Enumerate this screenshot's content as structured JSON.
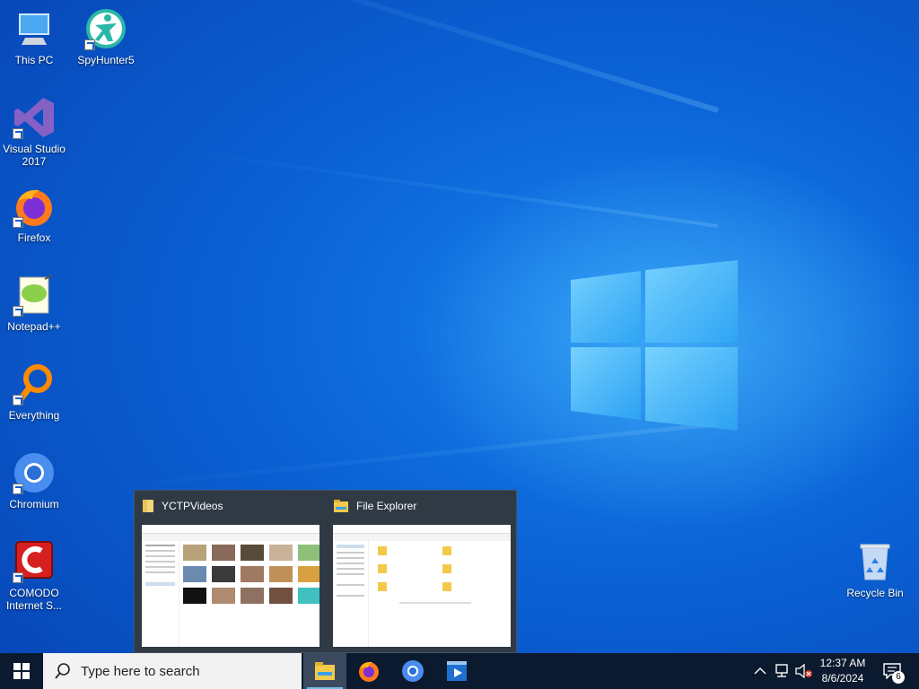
{
  "desktop": {
    "icons": [
      {
        "label": "This PC",
        "icon": "this-pc-icon"
      },
      {
        "label": "SpyHunter5",
        "icon": "spyhunter-icon"
      },
      {
        "label": "Visual Studio 2017",
        "icon": "visual-studio-icon"
      },
      {
        "label": "Firefox",
        "icon": "firefox-icon"
      },
      {
        "label": "Notepad++",
        "icon": "notepadpp-icon"
      },
      {
        "label": "Everything",
        "icon": "everything-icon"
      },
      {
        "label": "Chromium",
        "icon": "chromium-icon"
      },
      {
        "label": "COMODO Internet S...",
        "icon": "comodo-icon"
      },
      {
        "label": "Recycle Bin",
        "icon": "recycle-bin-icon"
      }
    ]
  },
  "preview": {
    "windows": [
      {
        "title": "YCTPVideos",
        "icon": "folder-icon"
      },
      {
        "title": "File Explorer",
        "icon": "file-explorer-icon"
      }
    ]
  },
  "taskbar": {
    "search_placeholder": "Type here to search",
    "apps": [
      "file-explorer-icon",
      "firefox-icon",
      "chromium-icon",
      "media-player-icon"
    ],
    "clock_time": "12:37 AM",
    "clock_date": "8/6/2024",
    "notification_count": "6"
  },
  "colors": {
    "desktop_bg": "#0b63d6",
    "taskbar_bg": "#0b1a2e",
    "preview_bg": "#2f3a45",
    "accent": "#76b9ed"
  }
}
